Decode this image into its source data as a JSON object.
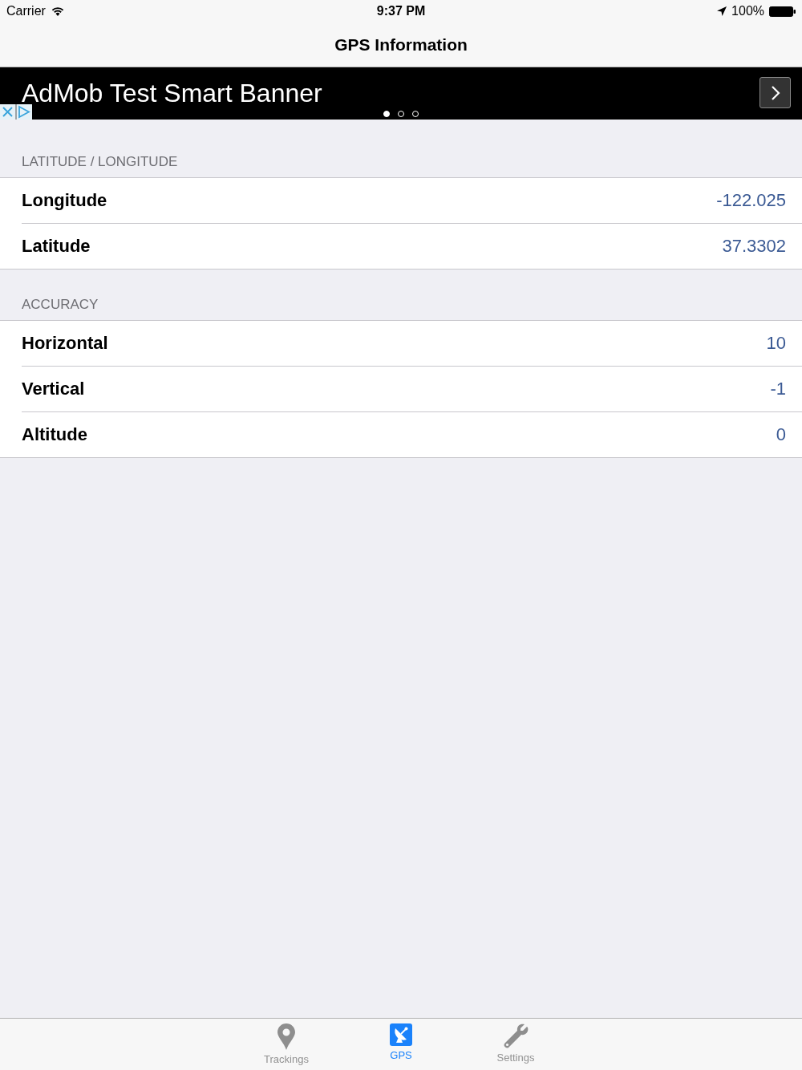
{
  "status_bar": {
    "carrier": "Carrier",
    "time": "9:37 PM",
    "battery": "100%"
  },
  "nav_bar": {
    "title": "GPS Information"
  },
  "ad_banner": {
    "text": "AdMob Test Smart Banner",
    "pages": [
      {
        "selected": true
      },
      {
        "selected": false
      },
      {
        "selected": false
      }
    ]
  },
  "sections": [
    {
      "header": "LATITUDE / LONGITUDE",
      "rows": [
        {
          "label": "Longitude",
          "value": "-122.025"
        },
        {
          "label": "Latitude",
          "value": "37.3302"
        }
      ]
    },
    {
      "header": "ACCURACY",
      "rows": [
        {
          "label": "Horizontal",
          "value": "10"
        },
        {
          "label": "Vertical",
          "value": "-1"
        },
        {
          "label": "Altitude",
          "value": "0"
        }
      ]
    }
  ],
  "tab_bar": {
    "items": [
      {
        "label": "Trackings",
        "selected": false
      },
      {
        "label": "GPS",
        "selected": true
      },
      {
        "label": "Settings",
        "selected": false
      }
    ]
  }
}
